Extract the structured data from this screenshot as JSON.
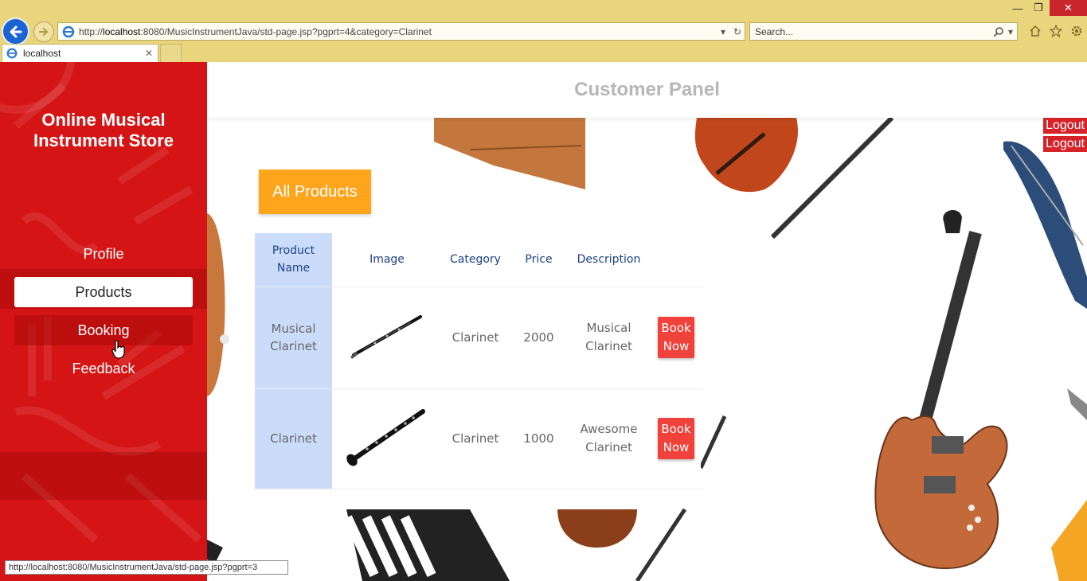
{
  "browser": {
    "url_prefix": "http://",
    "url_host": "localhost",
    "url_rest": ":8080/MusicInstrumentJava/std-page.jsp?pgprt=4&category=Clarinet",
    "search_placeholder": "Search...",
    "tab_title": "localhost",
    "status_url": "http://localhost:8080/MusicInstrumentJava/std-page.jsp?pgprt=3"
  },
  "sidebar": {
    "brand_line1": "Online Musical",
    "brand_line2": "Instrument Store",
    "items": [
      {
        "label": "Profile"
      },
      {
        "label": "Products"
      },
      {
        "label": "Booking"
      },
      {
        "label": "Feedback"
      }
    ]
  },
  "header": {
    "title": "Customer Panel"
  },
  "logout_label": "Logout",
  "all_products_label": "All Products",
  "table": {
    "columns": [
      "Product",
      "Name",
      "Image",
      "Category",
      "Price",
      "Description"
    ],
    "rows": [
      {
        "name1": "Musical",
        "name2": "Clarinet",
        "category": "Clarinet",
        "price": "2000",
        "desc1": "Musical",
        "desc2": "Clarinet"
      },
      {
        "name1": "Clarinet",
        "name2": "",
        "category": "Clarinet",
        "price": "1000",
        "desc1": "Awesome",
        "desc2": "Clarinet"
      }
    ],
    "book1": "Book",
    "book2": "Now"
  },
  "colors": {
    "sidebar": "#d51515",
    "accent": "#fea51c",
    "book_button": "#f0413a",
    "name_column": "#cbdcfb"
  }
}
